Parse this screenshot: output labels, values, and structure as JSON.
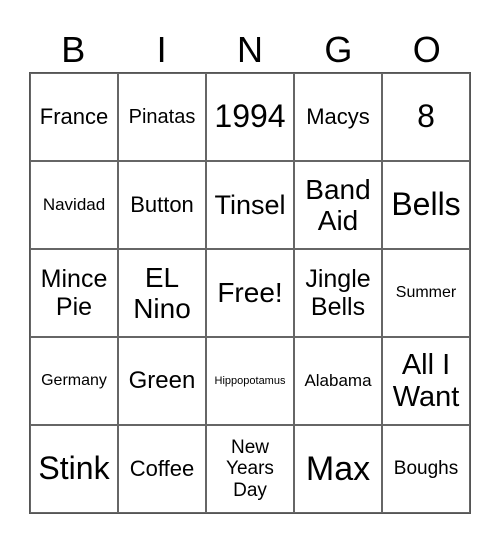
{
  "header": [
    "B",
    "I",
    "N",
    "G",
    "O"
  ],
  "cells": [
    {
      "text": "France",
      "size": 22
    },
    {
      "text": "Pinatas",
      "size": 20
    },
    {
      "text": "1994",
      "size": 32
    },
    {
      "text": "Macys",
      "size": 22
    },
    {
      "text": "8",
      "size": 32
    },
    {
      "text": "Navidad",
      "size": 17
    },
    {
      "text": "Button",
      "size": 22
    },
    {
      "text": "Tinsel",
      "size": 27
    },
    {
      "text": "Band\nAid",
      "size": 28
    },
    {
      "text": "Bells",
      "size": 32
    },
    {
      "text": "Mince\nPie",
      "size": 25
    },
    {
      "text": "EL\nNino",
      "size": 28
    },
    {
      "text": "Free!",
      "size": 28
    },
    {
      "text": "Jingle\nBells",
      "size": 25
    },
    {
      "text": "Summer",
      "size": 16
    },
    {
      "text": "Germany",
      "size": 16
    },
    {
      "text": "Green",
      "size": 24
    },
    {
      "text": "Hippopotamus",
      "size": 11
    },
    {
      "text": "Alabama",
      "size": 17
    },
    {
      "text": "All I\nWant",
      "size": 29
    },
    {
      "text": "Stink",
      "size": 32
    },
    {
      "text": "Coffee",
      "size": 22
    },
    {
      "text": "New\nYears\nDay",
      "size": 19
    },
    {
      "text": "Max",
      "size": 34
    },
    {
      "text": "Boughs",
      "size": 19
    }
  ]
}
